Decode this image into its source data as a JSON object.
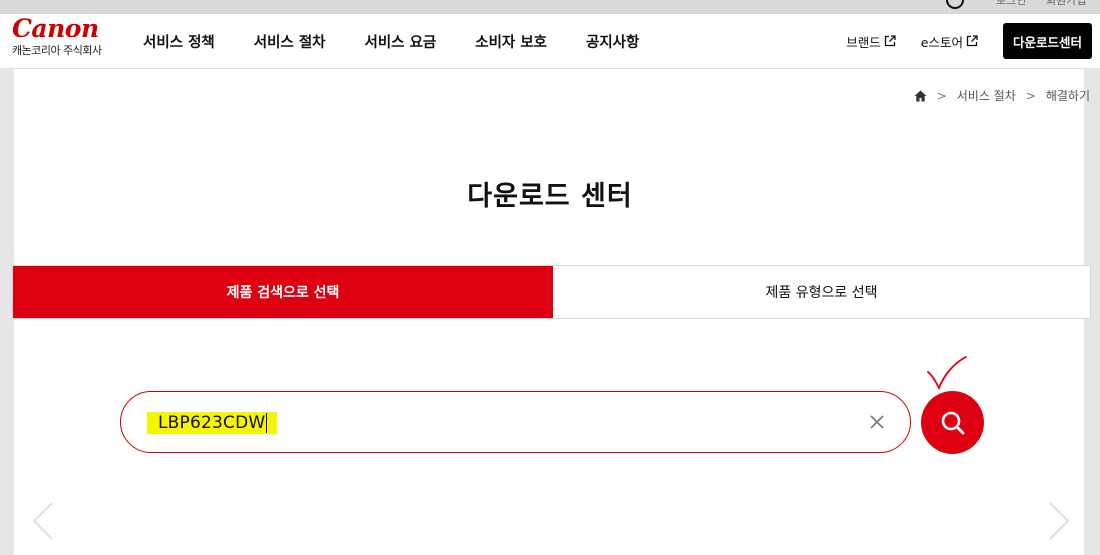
{
  "utility": {
    "item1": "로그인",
    "item2": "회원가입"
  },
  "logo": {
    "wordmark": "Canon",
    "company": "캐논코리아 주식회사"
  },
  "nav": [
    "서비스 정책",
    "서비스 절차",
    "서비스 요금",
    "소비자 보호",
    "공지사항"
  ],
  "right_nav": {
    "brand": "브랜드",
    "estore": "e스토어",
    "download": "다운로드센터"
  },
  "breadcrumb": {
    "level1": "서비스 절차",
    "level2": "해결하기"
  },
  "page_title": "다운로드 센터",
  "tabs": {
    "by_search": "제품 검색으로 선택",
    "by_type": "제품 유형으로 선택"
  },
  "search": {
    "value": "LBP623CDW"
  },
  "icons": {
    "home": "home-icon",
    "search": "search-icon",
    "clear": "close-icon",
    "external": "external-link-icon",
    "prev": "chevron-left-icon",
    "next": "chevron-right-icon"
  },
  "colors": {
    "brand_red": "#dd0011",
    "highlight_yellow": "#f5f500",
    "button_black": "#000000"
  }
}
